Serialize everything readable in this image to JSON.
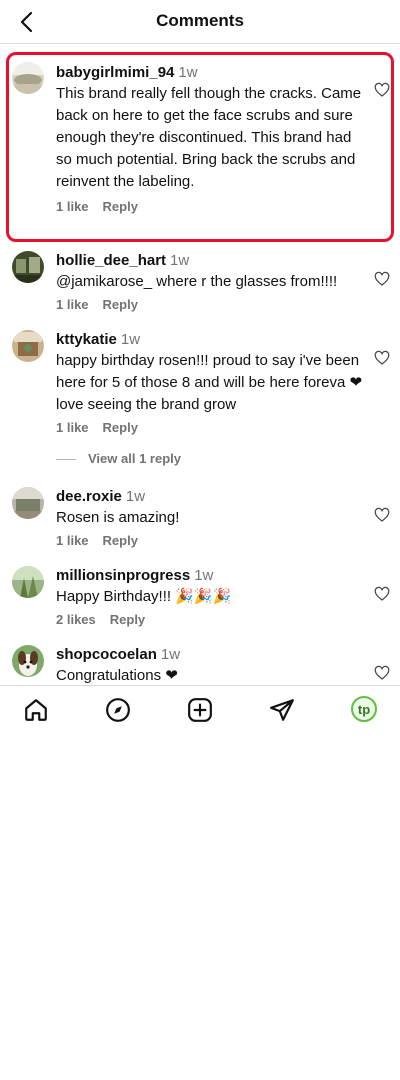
{
  "header": {
    "title": "Comments",
    "back_icon": "chevron-left-icon"
  },
  "comments": [
    {
      "username": "babygirlmimi_94",
      "time": "1w",
      "text": "This brand really fell though the cracks. Came back on here to get the face scrubs and sure enough they're discontinued. This brand had so much potential. Bring back the scrubs and reinvent the labeling.",
      "likes": "1 like",
      "reply": "Reply",
      "highlighted": true
    },
    {
      "username": "hollie_dee_hart",
      "time": "1w",
      "text": "@jamikarose_ where r the glasses from!!!!",
      "likes": "1 like",
      "reply": "Reply"
    },
    {
      "username": "kttykatie",
      "time": "1w",
      "text": "happy birthday rosen!!! proud to say i've been here for 5 of those 8 and will be here foreva ❤ love seeing the brand grow",
      "likes": "1 like",
      "reply": "Reply",
      "view_replies": "View all 1 reply"
    },
    {
      "username": "dee.roxie",
      "time": "1w",
      "text": "Rosen is amazing!",
      "likes": "1 like",
      "reply": "Reply"
    },
    {
      "username": "millionsinprogress",
      "time": "1w",
      "text": "Happy Birthday!!! 🎉🎉🎉",
      "likes": "2 likes",
      "reply": "Reply"
    },
    {
      "username": "shopcocoelan",
      "time": "1w",
      "text": "Congratulations ❤",
      "likes": "",
      "reply": ""
    }
  ],
  "bottom_nav": {
    "items": [
      "home-icon",
      "explore-icon",
      "create-icon",
      "direct-message-icon"
    ],
    "profile_initials": "tp"
  },
  "colors": {
    "highlight": "#e8112d",
    "secondary_text": "#737373",
    "profile_ring": "#5fbf3a"
  }
}
